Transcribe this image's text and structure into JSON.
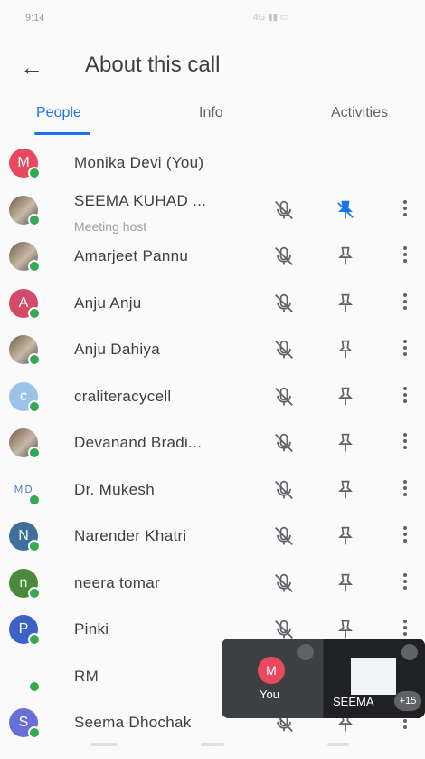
{
  "status": {
    "time": "9:14",
    "icons": "4G ▮▮ ▭"
  },
  "header": {
    "back_icon": "arrow-back-icon",
    "title": "About this call"
  },
  "tabs": [
    {
      "label": "People",
      "active": true
    },
    {
      "label": "Info",
      "active": false
    },
    {
      "label": "Activities",
      "active": false
    }
  ],
  "participants": [
    {
      "initial": "M",
      "name": "Monika Devi (You)",
      "color": "#e8495e",
      "controls": false
    },
    {
      "initial": "",
      "name": "SEEMA KUHAD ...",
      "sub": "Meeting host",
      "photo": true,
      "pinned": true
    },
    {
      "initial": "",
      "name": "Amarjeet Pannu",
      "photo": true
    },
    {
      "initial": "A",
      "name": "Anju Anju",
      "color": "#d44a6a"
    },
    {
      "initial": "",
      "name": "Anju Dahiya",
      "photo": true
    },
    {
      "initial": "c",
      "name": "craliteracycell",
      "color": "#9cc3e6"
    },
    {
      "initial": "",
      "name": "Devanand Bradi...",
      "photo": true
    },
    {
      "initial": "",
      "name": "Dr. Mukesh",
      "logo": "ＭＤ"
    },
    {
      "initial": "N",
      "name": "Narender Khatri",
      "color": "#3f6f9a"
    },
    {
      "initial": "n",
      "name": "neera tomar",
      "color": "#4a8a3a"
    },
    {
      "initial": "P",
      "name": "Pinki",
      "color": "#3b62c4"
    },
    {
      "initial": "",
      "name": "RM",
      "blank": true
    },
    {
      "initial": "S",
      "name": "Seema Dhochak",
      "color": "#6a6fd8"
    }
  ],
  "pip": {
    "you_initial": "M",
    "you_label": "You",
    "other_label": "SEEMA",
    "more_count": "+15"
  }
}
